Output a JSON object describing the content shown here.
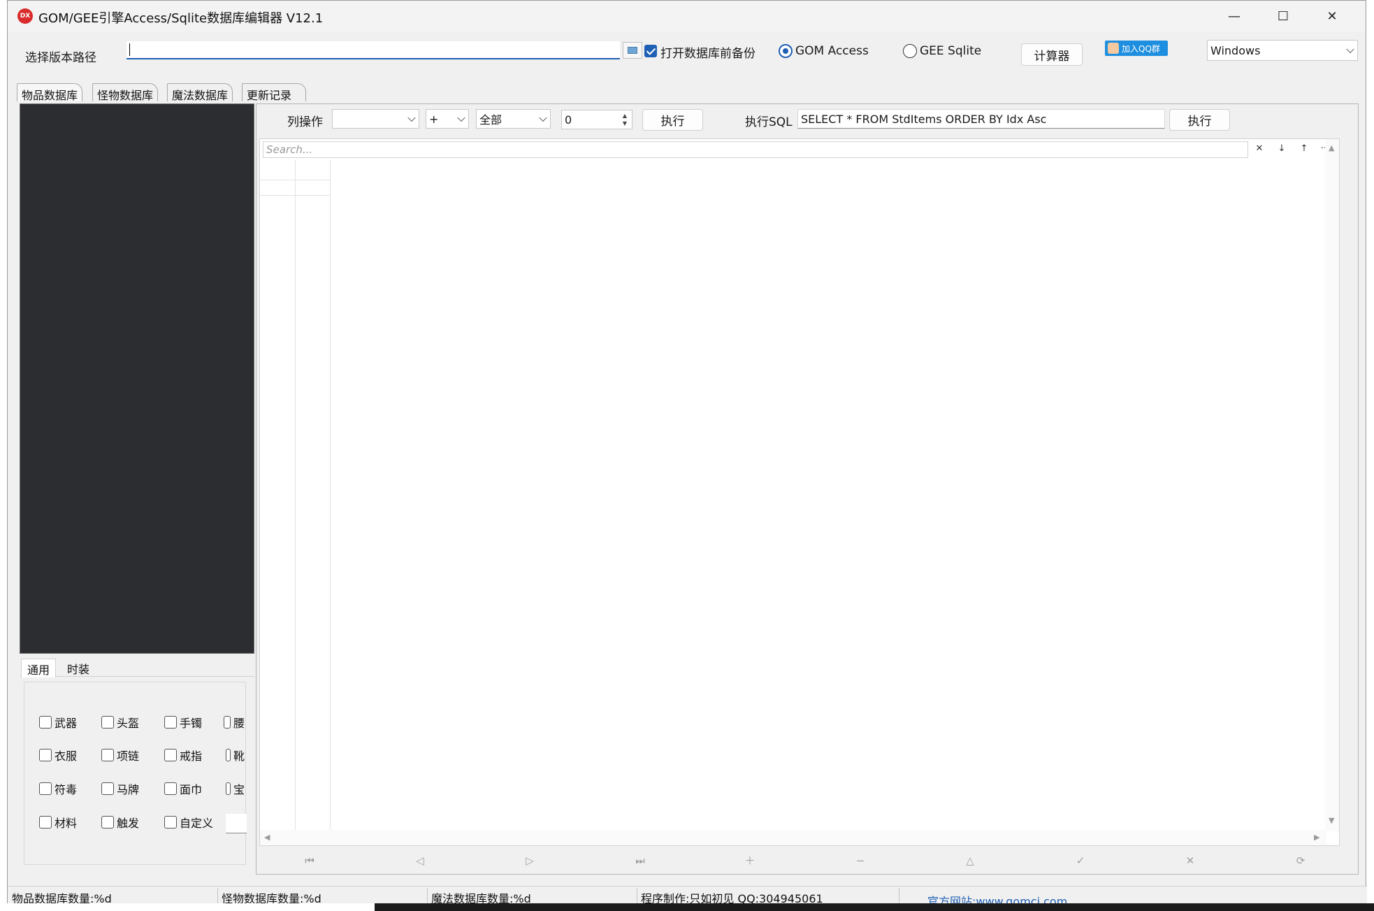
{
  "window": {
    "icon_text": "DX",
    "title": "GOM/GEE引擎Access/Sqlite数据库编辑器 V12.1",
    "minimize_glyph": "—",
    "maximize_glyph": "☐",
    "close_glyph": "✕"
  },
  "toolbar": {
    "path_label": "选择版本路径",
    "path_value": "",
    "backup_label": "打开数据库前备份",
    "backup_checked": true,
    "engine_options": [
      {
        "label": "GOM Access",
        "selected": true
      },
      {
        "label": "GEE Sqlite",
        "selected": false
      }
    ],
    "calculator_label": "计算器",
    "qq_badge_label": "加入QQ群",
    "theme_select": "Windows"
  },
  "tabs": [
    {
      "label": "物品数据库",
      "active": true
    },
    {
      "label": "怪物数据库",
      "active": false
    },
    {
      "label": "魔法数据库",
      "active": false
    },
    {
      "label": "更新记录",
      "active": false
    }
  ],
  "filter": {
    "subtabs": [
      {
        "label": "通用",
        "active": true
      },
      {
        "label": "时装",
        "active": false
      }
    ],
    "checkboxes": [
      [
        "武器",
        "头盔",
        "手镯",
        "腰"
      ],
      [
        "衣服",
        "项链",
        "戒指",
        "靴"
      ],
      [
        "符毒",
        "马牌",
        "面巾",
        "宝"
      ],
      [
        "材料",
        "触发",
        "自定义"
      ]
    ]
  },
  "column_ops": {
    "label": "列操作",
    "column_select": "",
    "operator_select": "+",
    "scope_select": "全部",
    "value": "0",
    "execute_label": "执行"
  },
  "sql": {
    "label": "执行SQL",
    "query": "SELECT * FROM StdItems ORDER BY Idx Asc",
    "execute_label": "执行"
  },
  "grid": {
    "search_placeholder": "Search..."
  },
  "navigator": {
    "buttons": [
      "first",
      "prior",
      "next",
      "last",
      "insert",
      "delete",
      "edit",
      "post",
      "cancel",
      "refresh"
    ]
  },
  "status": {
    "items_count": "物品数据库数量:%d",
    "monsters_count": "怪物数据库数量:%d",
    "magic_count": "魔法数据库数量:%d",
    "author": "程序制作:只如初见 QQ:304945061",
    "website": "官方网站:www.gomcj.com"
  },
  "colors": {
    "accent": "#1f5fb4",
    "tree_background": "#2b2d30",
    "app_icon": "#d92b2b"
  }
}
